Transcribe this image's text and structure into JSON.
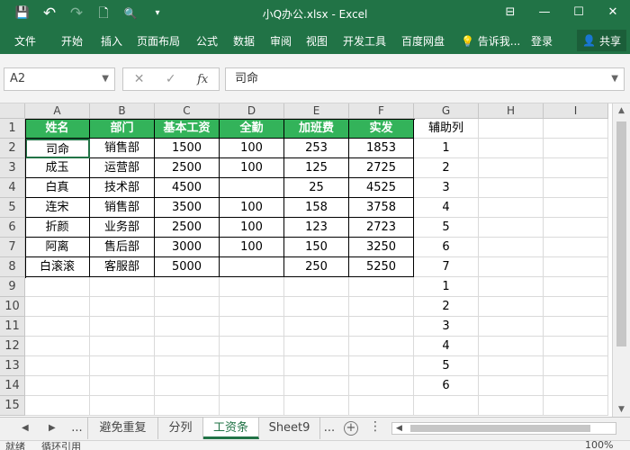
{
  "titlebar": {
    "doc_title": "小Q办公.xlsx - Excel",
    "qat": [
      {
        "name": "save-icon",
        "glyph": "💾"
      },
      {
        "name": "undo-icon",
        "glyph": "↶"
      },
      {
        "name": "redo-icon",
        "glyph": "↷"
      },
      {
        "name": "new-file-icon",
        "glyph": "🗋"
      },
      {
        "name": "print-preview-icon",
        "glyph": "🔍"
      },
      {
        "name": "customize-qat-icon",
        "glyph": "▾"
      }
    ],
    "window_controls": [
      "⊟",
      "—",
      "☐",
      "✕"
    ]
  },
  "ribbon": {
    "tabs": [
      "文件",
      "开始",
      "插入",
      "页面布局",
      "公式",
      "数据",
      "审阅",
      "视图",
      "开发工具",
      "百度网盘"
    ],
    "tell_me": "告诉我...",
    "login": "登录",
    "share": "共享"
  },
  "formula_bar": {
    "name_box": "A2",
    "cancel": "✕",
    "confirm": "✓",
    "fx": "fx",
    "value": "司命"
  },
  "columns": [
    "A",
    "B",
    "C",
    "D",
    "E",
    "F",
    "G",
    "H",
    "I"
  ],
  "rows": [
    "1",
    "2",
    "3",
    "4",
    "5",
    "6",
    "7",
    "8",
    "9",
    "10",
    "11",
    "12",
    "13",
    "14",
    "15"
  ],
  "table": {
    "header": [
      "姓名",
      "部门",
      "基本工资",
      "全勤",
      "加班费",
      "实发"
    ],
    "rows": [
      [
        "司命",
        "销售部",
        "1500",
        "100",
        "253",
        "1853"
      ],
      [
        "成玉",
        "运营部",
        "2500",
        "100",
        "125",
        "2725"
      ],
      [
        "白真",
        "技术部",
        "4500",
        "",
        "25",
        "4525"
      ],
      [
        "连宋",
        "销售部",
        "3500",
        "100",
        "158",
        "3758"
      ],
      [
        "折颜",
        "业务部",
        "2500",
        "100",
        "123",
        "2723"
      ],
      [
        "阿离",
        "售后部",
        "3000",
        "100",
        "150",
        "3250"
      ],
      [
        "白滚滚",
        "客服部",
        "5000",
        "",
        "250",
        "5250"
      ]
    ]
  },
  "helper_column": {
    "header": "辅助列",
    "values": [
      "1",
      "2",
      "3",
      "4",
      "5",
      "6",
      "7",
      "1",
      "2",
      "3",
      "4",
      "5",
      "6"
    ]
  },
  "sheets": {
    "ellipsis": "...",
    "tabs": [
      "避免重复",
      "分列",
      "工资条",
      "Sheet9"
    ],
    "active": "工资条",
    "ellipsis_right": "..."
  },
  "statusbar": {
    "left": "就绪",
    "mid": "循环引用",
    "zoom": "100%"
  }
}
